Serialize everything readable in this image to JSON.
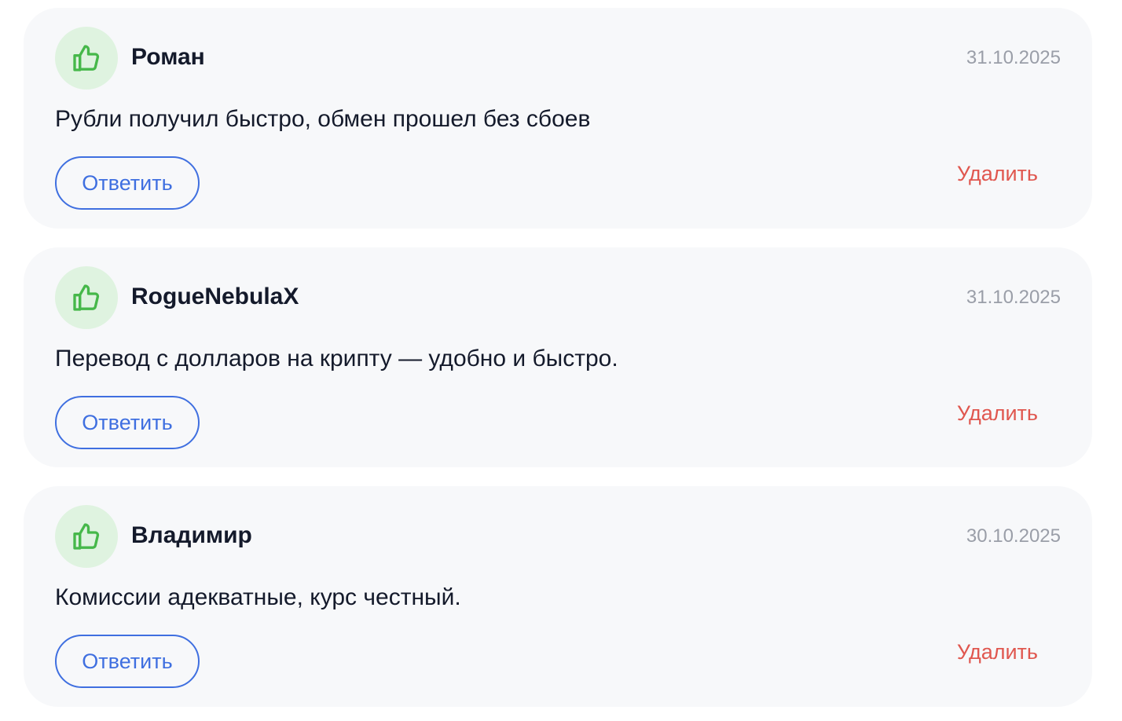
{
  "colors": {
    "card_background": "#f7f8fa",
    "avatar_background": "#dff3e0",
    "thumb_icon": "#46b84a",
    "reply_accent": "#3f6fe0",
    "delete_text": "#e0574f",
    "date_text": "#9a9ea8",
    "primary_text": "#141a2b"
  },
  "reviews": [
    {
      "icon": "thumbs-up-icon",
      "author": "Роман",
      "date": "31.10.2025",
      "text": "Рубли получил быстро, обмен прошел без сбоев",
      "reply_label": "Ответить",
      "delete_label": "Удалить"
    },
    {
      "icon": "thumbs-up-icon",
      "author": "RogueNebulaX",
      "date": "31.10.2025",
      "text": "Перевод с долларов на крипту — удобно и быстро.",
      "reply_label": "Ответить",
      "delete_label": "Удалить"
    },
    {
      "icon": "thumbs-up-icon",
      "author": "Владимир",
      "date": "30.10.2025",
      "text": "Комиссии адекватные, курс честный.",
      "reply_label": "Ответить",
      "delete_label": "Удалить"
    }
  ]
}
